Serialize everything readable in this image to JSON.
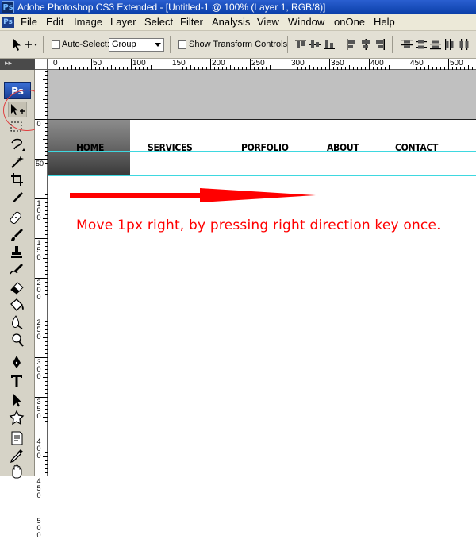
{
  "window": {
    "app_icon": "Ps",
    "title": "Adobe Photoshop CS3 Extended - [Untitled-1 @ 100% (Layer 1, RGB/8)]"
  },
  "menu": {
    "icon": "Ps",
    "items": [
      "File",
      "Edit",
      "Image",
      "Layer",
      "Select",
      "Filter",
      "Analysis",
      "View",
      "Window",
      "onOne",
      "Help"
    ]
  },
  "options": {
    "auto_select_label": "Auto-Select:",
    "auto_select_value": "Group",
    "show_transform_label": "Show Transform Controls"
  },
  "tools": {
    "logo": "Ps",
    "grip_glyph": "▸▸",
    "items": [
      "move-tool",
      "marquee-tool",
      "lasso-tool",
      "magic-wand-tool",
      "crop-tool",
      "slice-tool",
      "healing-brush-tool",
      "brush-tool",
      "clone-stamp-tool",
      "history-brush-tool",
      "eraser-tool",
      "paint-bucket-tool",
      "blur-tool",
      "dodge-tool",
      "pen-tool",
      "type-tool",
      "path-selection-tool",
      "custom-shape-tool",
      "notes-tool",
      "eyedropper-tool",
      "hand-tool"
    ]
  },
  "ruler": {
    "top_numbers": [
      "0",
      "50",
      "100",
      "150",
      "200",
      "250",
      "300",
      "350",
      "400",
      "450",
      "500"
    ],
    "left_numbers": [
      "0",
      "50",
      "100",
      "150",
      "200",
      "250",
      "300",
      "350",
      "400",
      "450",
      "500"
    ]
  },
  "canvas": {
    "nav": [
      "HOME",
      "SERVICES",
      "PORFOLIO",
      "ABOUT",
      "CONTACT"
    ]
  },
  "annotation": {
    "text": "Move 1px right, by pressing right direction key once.",
    "color": "#ff0000"
  },
  "colors": {
    "titlebar": "#0a3ea8",
    "guide": "#3ed8e0",
    "header_gray": "#c0c0c0"
  }
}
